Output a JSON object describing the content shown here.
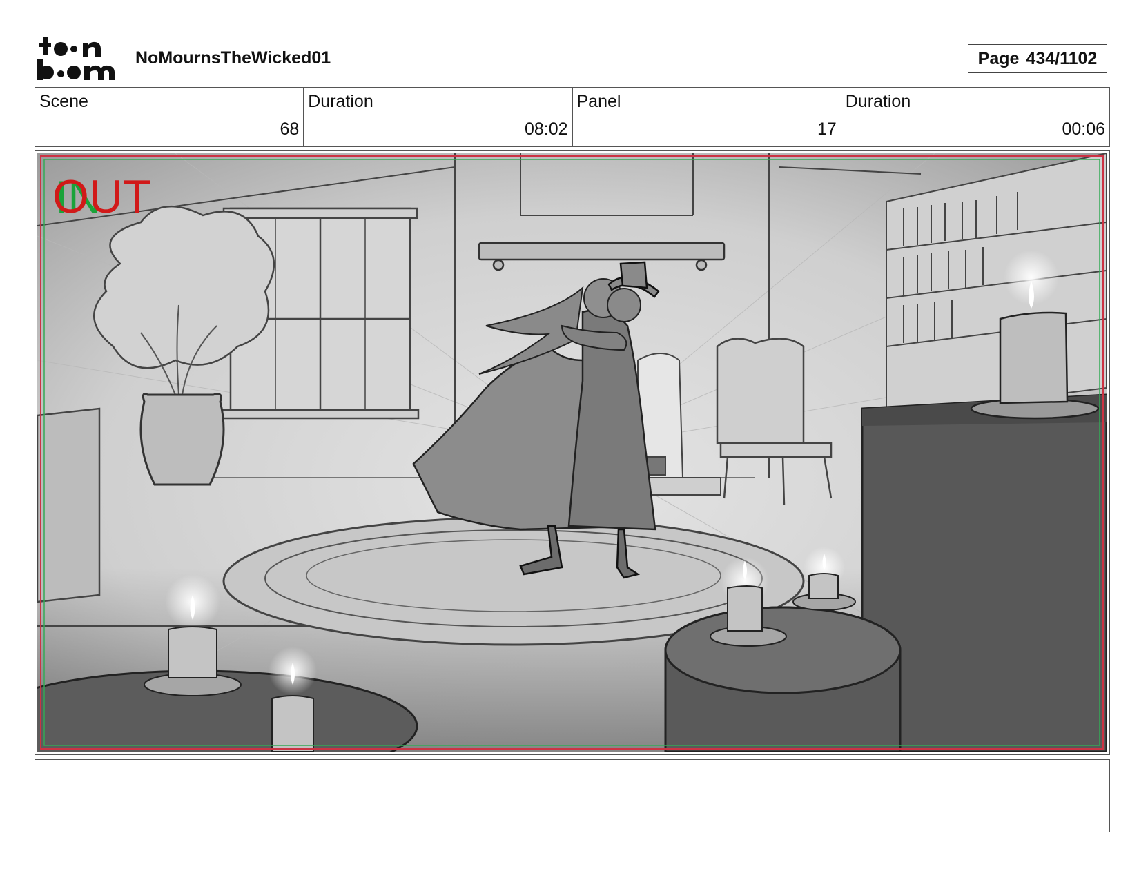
{
  "header": {
    "logo_text_top": "toon",
    "logo_text_bottom": "boom",
    "project_title": "NoMournsTheWicked01",
    "page_label": "Page",
    "page_value": "434/1102"
  },
  "info": [
    {
      "label": "Scene",
      "value": "68"
    },
    {
      "label": "Duration",
      "value": "08:02"
    },
    {
      "label": "Panel",
      "value": "17"
    },
    {
      "label": "Duration",
      "value": "00:06"
    }
  ],
  "panel": {
    "transition_in": "IN",
    "transition_out": "OUT"
  },
  "notes": {
    "text": ""
  },
  "colors": {
    "out_red": "#d11919",
    "in_green": "#1aa33a",
    "frame_red": "#cc3344",
    "frame_green": "#33aa55"
  }
}
